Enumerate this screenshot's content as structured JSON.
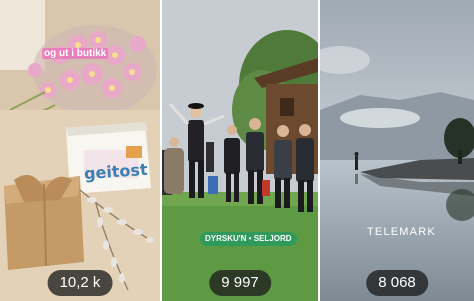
{
  "tiles": [
    {
      "caption": "og ut i butikk",
      "product_label": "geitost",
      "view_count": "10,2 k"
    },
    {
      "badge": "DYRSKU'N • SELJORD",
      "view_count": "9 997"
    },
    {
      "caption": "TELEMARK",
      "view_count": "8 068"
    }
  ],
  "colors": {
    "count_pill_bg": "#1e1e1e",
    "caption_pink": "#eb6ebe",
    "badge_green": "#2f9a5a"
  }
}
